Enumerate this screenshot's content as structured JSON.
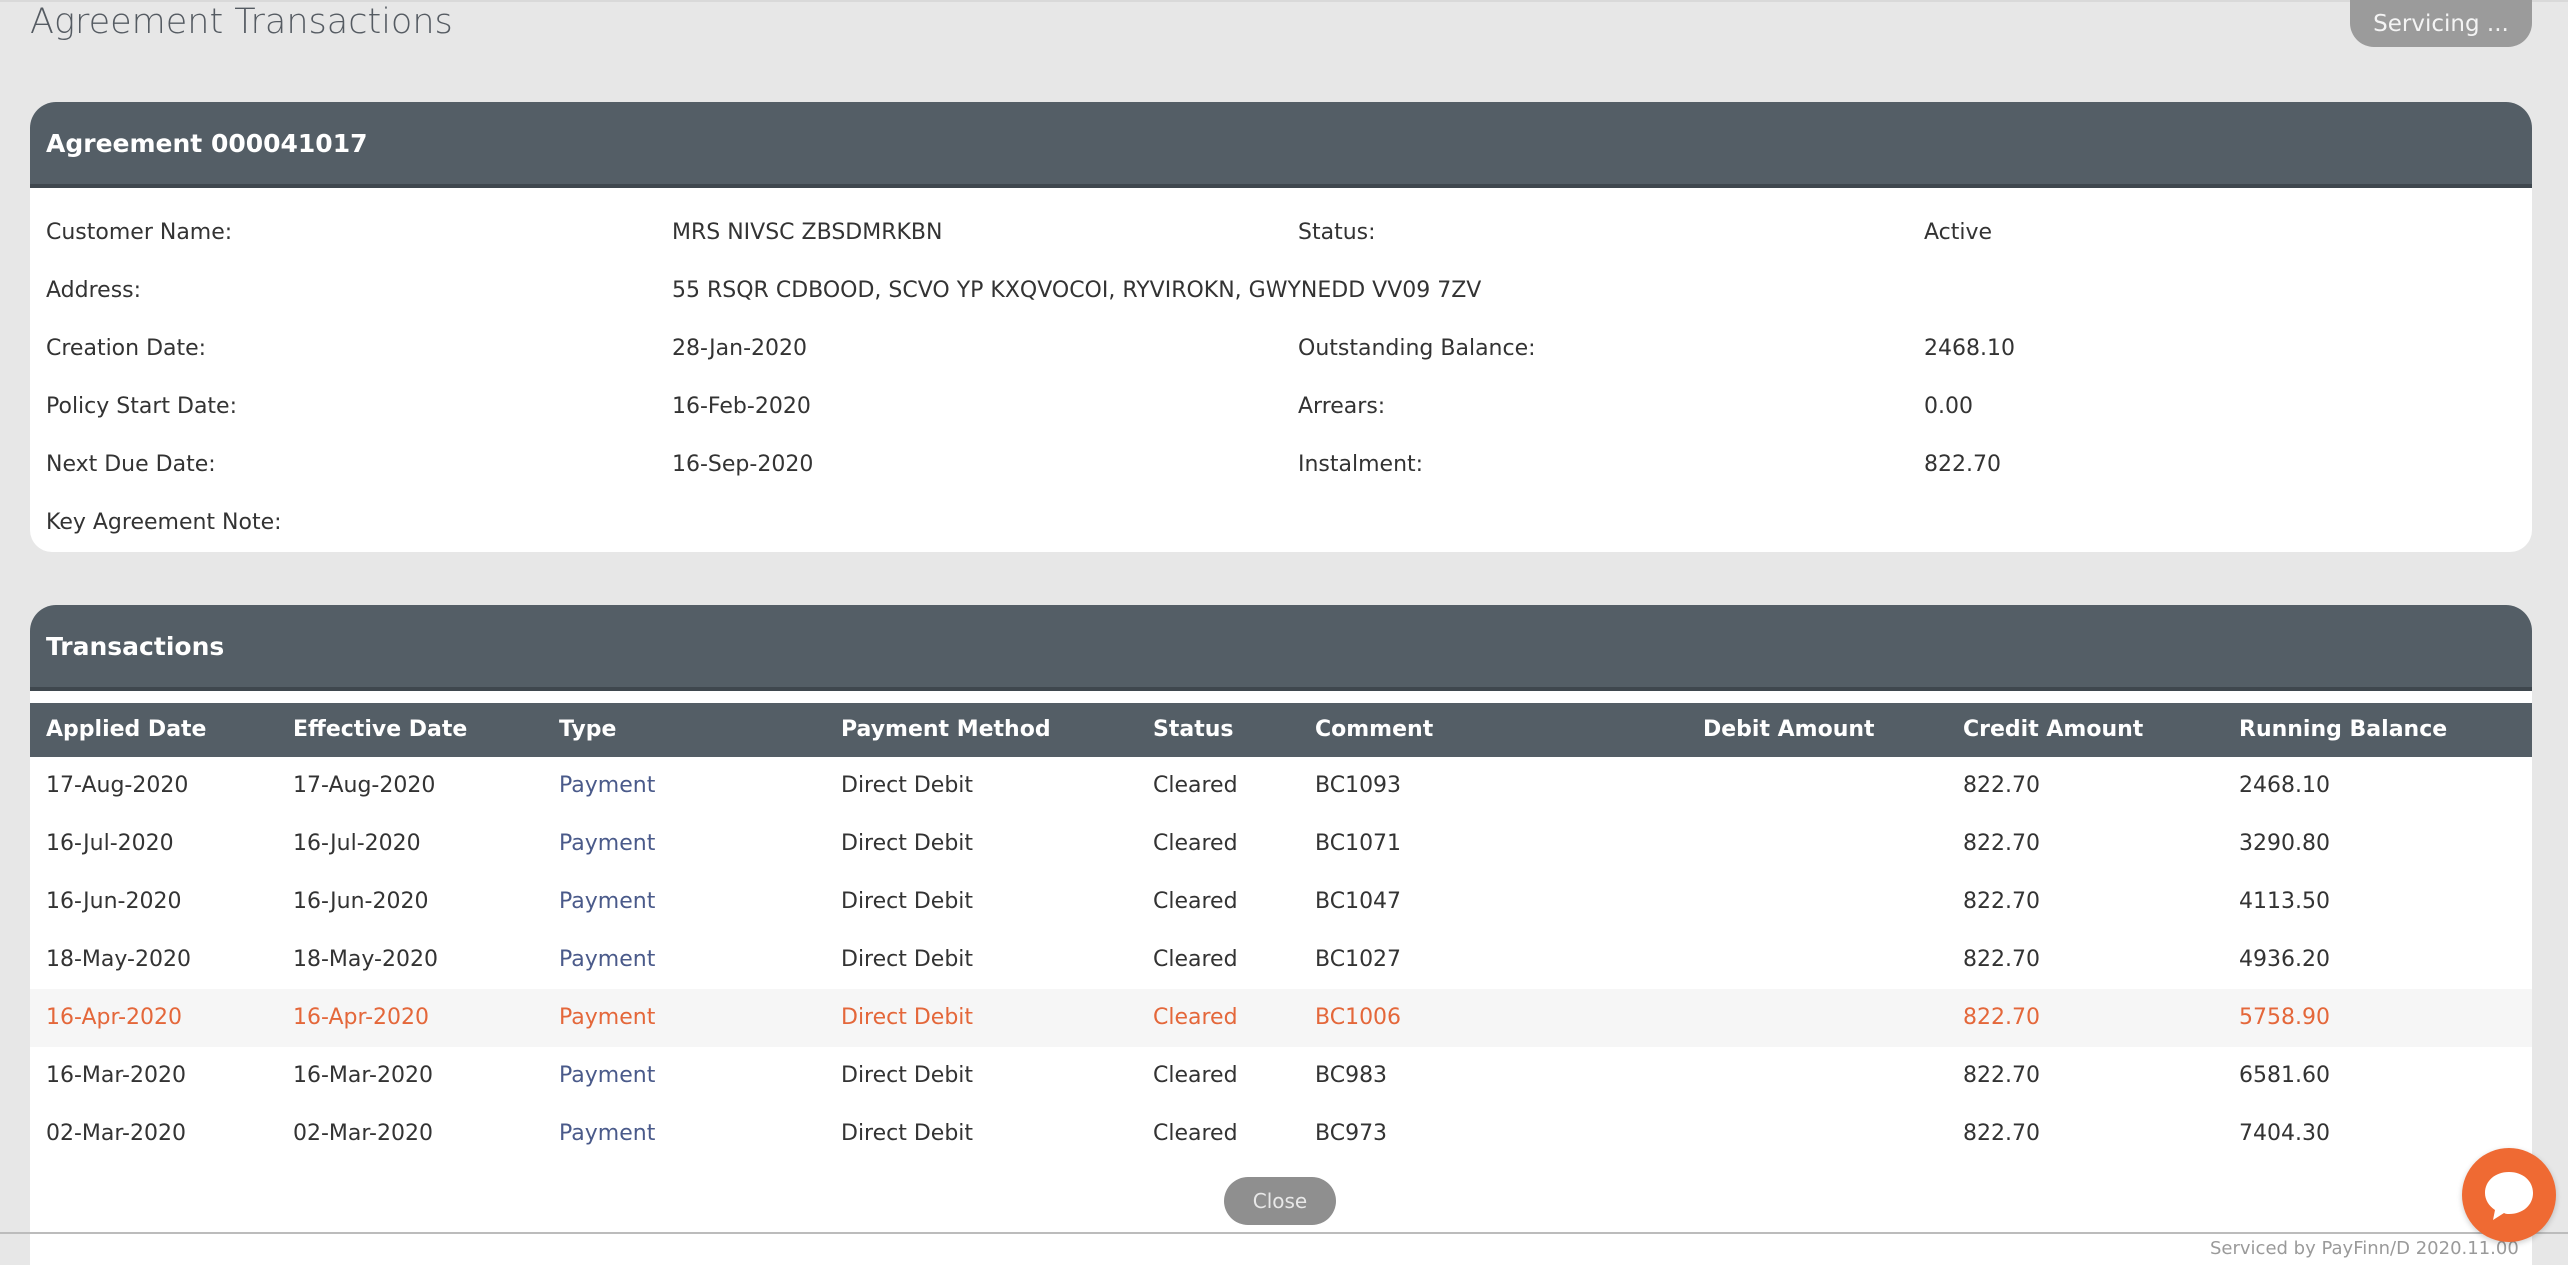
{
  "header": {
    "title": "Agreement Transactions",
    "servicing_label": "Servicing ..."
  },
  "agreement": {
    "title": "Agreement 000041017",
    "fields": {
      "customer_name_label": "Customer Name:",
      "customer_name_value": "MRS NIVSC ZBSDMRKBN",
      "status_label": "Status:",
      "status_value": "Active",
      "address_label": "Address:",
      "address_value": "55 RSQR CDBOOD, SCVO YP KXQVOCOI, RYVIROKN, GWYNEDD VV09 7ZV",
      "creation_date_label": "Creation Date:",
      "creation_date_value": "28-Jan-2020",
      "outstanding_label": "Outstanding Balance:",
      "outstanding_value": "2468.10",
      "policy_start_label": "Policy Start Date:",
      "policy_start_value": "16-Feb-2020",
      "arrears_label": "Arrears:",
      "arrears_value": "0.00",
      "next_due_label": "Next Due Date:",
      "next_due_value": "16-Sep-2020",
      "instalment_label": "Instalment:",
      "instalment_value": "822.70",
      "key_note_label": "Key Agreement Note:"
    }
  },
  "transactions": {
    "title": "Transactions",
    "columns": [
      "Applied Date",
      "Effective Date",
      "Type",
      "Payment Method",
      "Status",
      "Comment",
      "Debit Amount",
      "Credit Amount",
      "Running Balance"
    ],
    "rows": [
      {
        "applied": "17-Aug-2020",
        "effective": "17-Aug-2020",
        "type": "Payment",
        "method": "Direct Debit",
        "status": "Cleared",
        "comment": "BC1093",
        "debit": "",
        "credit": "822.70",
        "balance": "2468.10",
        "highlighted": false
      },
      {
        "applied": "16-Jul-2020",
        "effective": "16-Jul-2020",
        "type": "Payment",
        "method": "Direct Debit",
        "status": "Cleared",
        "comment": "BC1071",
        "debit": "",
        "credit": "822.70",
        "balance": "3290.80",
        "highlighted": false
      },
      {
        "applied": "16-Jun-2020",
        "effective": "16-Jun-2020",
        "type": "Payment",
        "method": "Direct Debit",
        "status": "Cleared",
        "comment": "BC1047",
        "debit": "",
        "credit": "822.70",
        "balance": "4113.50",
        "highlighted": false
      },
      {
        "applied": "18-May-2020",
        "effective": "18-May-2020",
        "type": "Payment",
        "method": "Direct Debit",
        "status": "Cleared",
        "comment": "BC1027",
        "debit": "",
        "credit": "822.70",
        "balance": "4936.20",
        "highlighted": false
      },
      {
        "applied": "16-Apr-2020",
        "effective": "16-Apr-2020",
        "type": "Payment",
        "method": "Direct Debit",
        "status": "Cleared",
        "comment": "BC1006",
        "debit": "",
        "credit": "822.70",
        "balance": "5758.90",
        "highlighted": true
      },
      {
        "applied": "16-Mar-2020",
        "effective": "16-Mar-2020",
        "type": "Payment",
        "method": "Direct Debit",
        "status": "Cleared",
        "comment": "BC983",
        "debit": "",
        "credit": "822.70",
        "balance": "6581.60",
        "highlighted": false
      },
      {
        "applied": "02-Mar-2020",
        "effective": "02-Mar-2020",
        "type": "Payment",
        "method": "Direct Debit",
        "status": "Cleared",
        "comment": "BC973",
        "debit": "",
        "credit": "822.70",
        "balance": "7404.30",
        "highlighted": false
      }
    ]
  },
  "footer": {
    "close_label": "Close",
    "footer_text": "Serviced by PayFinn/D 2020.11.00"
  },
  "colors": {
    "header_bg": "#545e66",
    "highlight_text": "#e4673a",
    "link_text": "#4a5a8a",
    "chat_button": "#ef6a33"
  },
  "icons": {
    "chat": "chat-bubble-icon"
  }
}
